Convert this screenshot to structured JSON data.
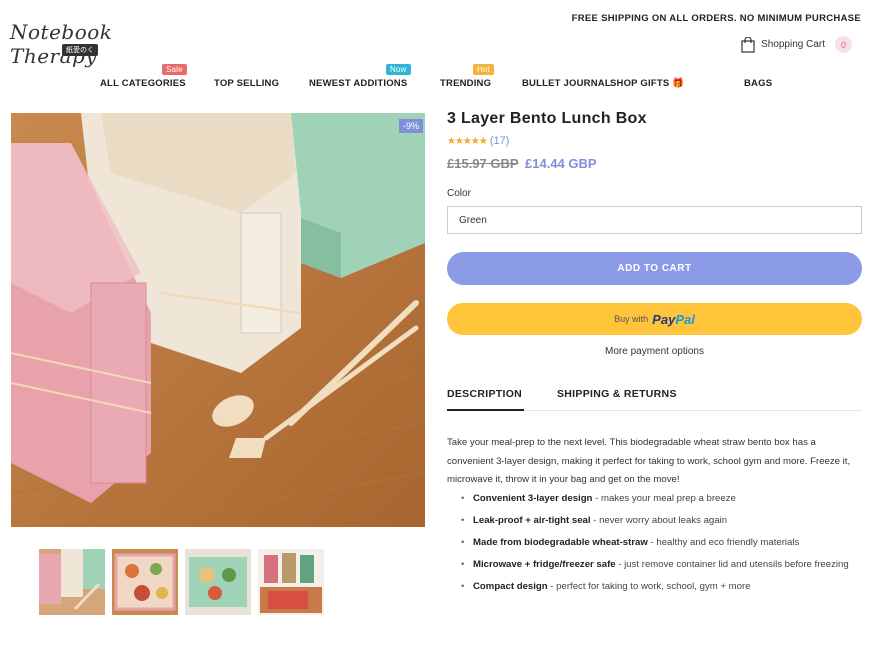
{
  "header": {
    "logo_text": "Notebook Therapy",
    "logo_sub": "紙愛のく",
    "promo": "FREE SHIPPING ON ALL ORDERS. NO MINIMUM PURCHASE",
    "cart_label": "Shopping Cart",
    "cart_count": "0"
  },
  "nav": {
    "items": [
      {
        "label": "ALL CATEGORIES",
        "badge": "Sale",
        "badge_color": "#e96a6a"
      },
      {
        "label": "TOP SELLING"
      },
      {
        "label": "NEWEST ADDITIONS",
        "badge": "Now",
        "badge_color": "#2fb5d9"
      },
      {
        "label": "TRENDING",
        "badge": "Hot",
        "badge_color": "#f3b33d"
      },
      {
        "label": "BULLET JOURNAL"
      },
      {
        "label": "SHOP GIFTS 🎁"
      },
      {
        "label": "BAGS"
      }
    ]
  },
  "product": {
    "discount": "-9%",
    "title": "3 Layer Bento Lunch Box",
    "stars": "★★★★★",
    "reviews": "(17)",
    "price_old": "£15.97 GBP",
    "price_new": "£14.44 GBP",
    "color_label": "Color",
    "color_value": "Green",
    "add_to_cart": "ADD TO CART",
    "buy_with": "Buy with",
    "paypal_1": "Pay",
    "paypal_2": "Pal",
    "more_payment": "More payment options"
  },
  "tabs": {
    "description": "DESCRIPTION",
    "shipping": "SHIPPING & RETURNS"
  },
  "description": {
    "intro": "Take your meal-prep to the next level. This biodegradable wheat straw bento box has a convenient 3-layer design, making it perfect for taking to work, school gym and more. Freeze it, microwave it, throw it in your bag and get on the move!",
    "bullets": [
      {
        "bold": "Convenient 3-layer design",
        "text": " - makes your meal prep a breeze"
      },
      {
        "bold": "Leak-proof + air-tight seal",
        "text": " - never worry about leaks again"
      },
      {
        "bold": "Made from biodegradable wheat-straw",
        "text": " - healthy and eco friendly materials"
      },
      {
        "bold": "Microwave + fridge/freezer safe",
        "text": " - just remove container lid and utensils before freezing"
      },
      {
        "bold": "Compact design",
        "text": " - perfect for taking to work, school, gym + more"
      }
    ]
  },
  "colors": {
    "accent": "#8c9be6",
    "paypal_yellow": "#ffc43a"
  }
}
